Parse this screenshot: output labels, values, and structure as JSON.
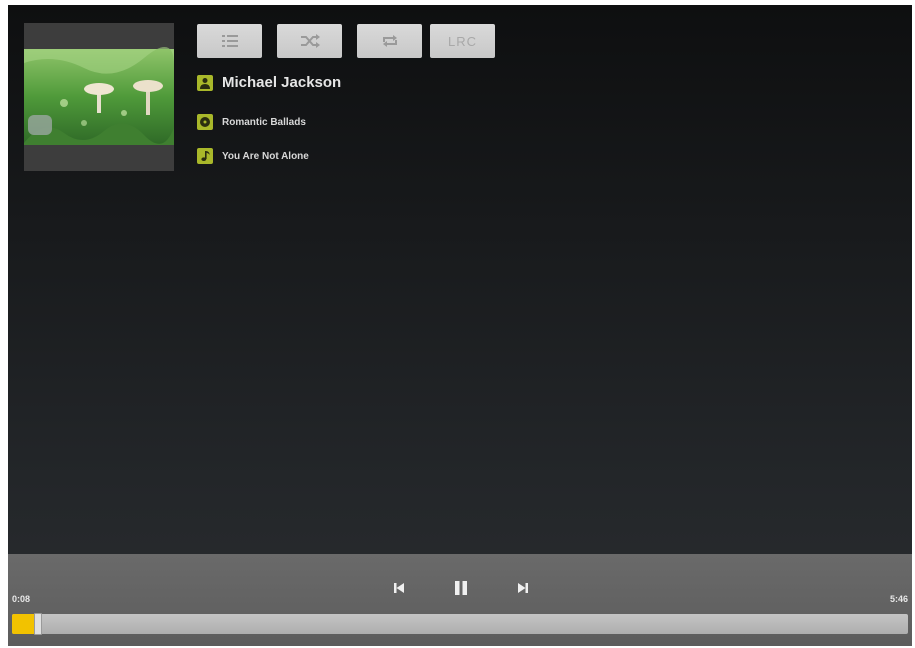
{
  "track": {
    "artist": "Michael Jackson",
    "album": "Romantic Ballads",
    "title": "You Are Not Alone"
  },
  "toolbar": {
    "playlist_icon": "playlist-icon",
    "shuffle_icon": "shuffle-icon",
    "repeat_icon": "repeat-icon",
    "lrc_label": "LRC"
  },
  "icons": {
    "artist": "person-icon",
    "album": "disc-icon",
    "title": "music-note-icon",
    "prev": "skip-previous-icon",
    "pause": "pause-icon",
    "next": "skip-next-icon"
  },
  "playback": {
    "elapsed": "0:08",
    "total": "5:46",
    "progress": 0.025
  },
  "colors": {
    "accent": "#a9b82a",
    "progress": "#f2c200"
  }
}
